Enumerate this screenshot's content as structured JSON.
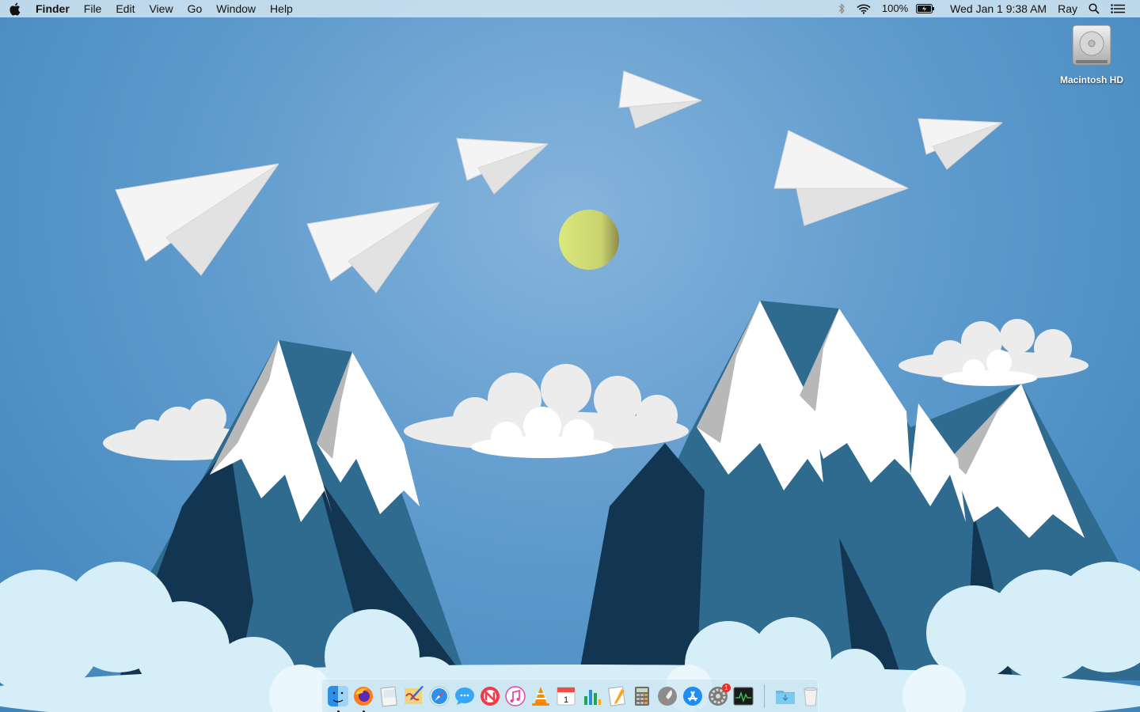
{
  "menubar": {
    "app_name": "Finder",
    "menus": [
      "File",
      "Edit",
      "View",
      "Go",
      "Window",
      "Help"
    ],
    "battery_percent": "100%",
    "datetime": "Wed Jan 1  9:38 AM",
    "user": "Ray",
    "status_icons": [
      "bluetooth-icon",
      "wifi-icon",
      "battery-charging-icon",
      "spotlight-icon",
      "notification-center-icon"
    ]
  },
  "desktop": {
    "icons": [
      {
        "label": "Macintosh HD",
        "icon": "hard-drive-icon"
      }
    ]
  },
  "dock": {
    "apps": [
      {
        "name": "Finder",
        "icon": "finder-icon",
        "running": true
      },
      {
        "name": "Firefox",
        "icon": "firefox-icon",
        "running": true
      },
      {
        "name": "Preview",
        "icon": "preview-icon",
        "running": false
      },
      {
        "name": "Paintbrush",
        "icon": "paintbrush-icon",
        "running": false
      },
      {
        "name": "Safari",
        "icon": "safari-icon",
        "running": false
      },
      {
        "name": "Messages",
        "icon": "messages-icon",
        "running": false
      },
      {
        "name": "News",
        "icon": "news-icon",
        "running": false
      },
      {
        "name": "iTunes",
        "icon": "itunes-icon",
        "running": false
      },
      {
        "name": "VLC",
        "icon": "vlc-icon",
        "running": false
      },
      {
        "name": "Calendar",
        "icon": "calendar-icon",
        "running": false,
        "date": "1"
      },
      {
        "name": "Numbers",
        "icon": "numbers-icon",
        "running": false
      },
      {
        "name": "Pages",
        "icon": "pages-icon",
        "running": false
      },
      {
        "name": "Calculator",
        "icon": "calculator-icon",
        "running": false
      },
      {
        "name": "Launchpad",
        "icon": "launchpad-icon",
        "running": false
      },
      {
        "name": "App Store",
        "icon": "app-store-icon",
        "running": false
      },
      {
        "name": "System Preferences",
        "icon": "system-preferences-icon",
        "running": false,
        "badge": "1"
      },
      {
        "name": "Activity Monitor",
        "icon": "activity-monitor-icon",
        "running": false
      }
    ],
    "stacks": [
      {
        "name": "Downloads",
        "icon": "downloads-folder-icon"
      },
      {
        "name": "Trash",
        "icon": "trash-icon"
      }
    ]
  },
  "colors": {
    "sky": "#5f9bcd",
    "mountain_dark": "#123552",
    "mountain_mid": "#2f6a8f",
    "snow": "#ffffff",
    "snow_shadow": "#b8b8b8",
    "sun": "#d6e27a",
    "cloud_fore": "#d5eef8"
  }
}
